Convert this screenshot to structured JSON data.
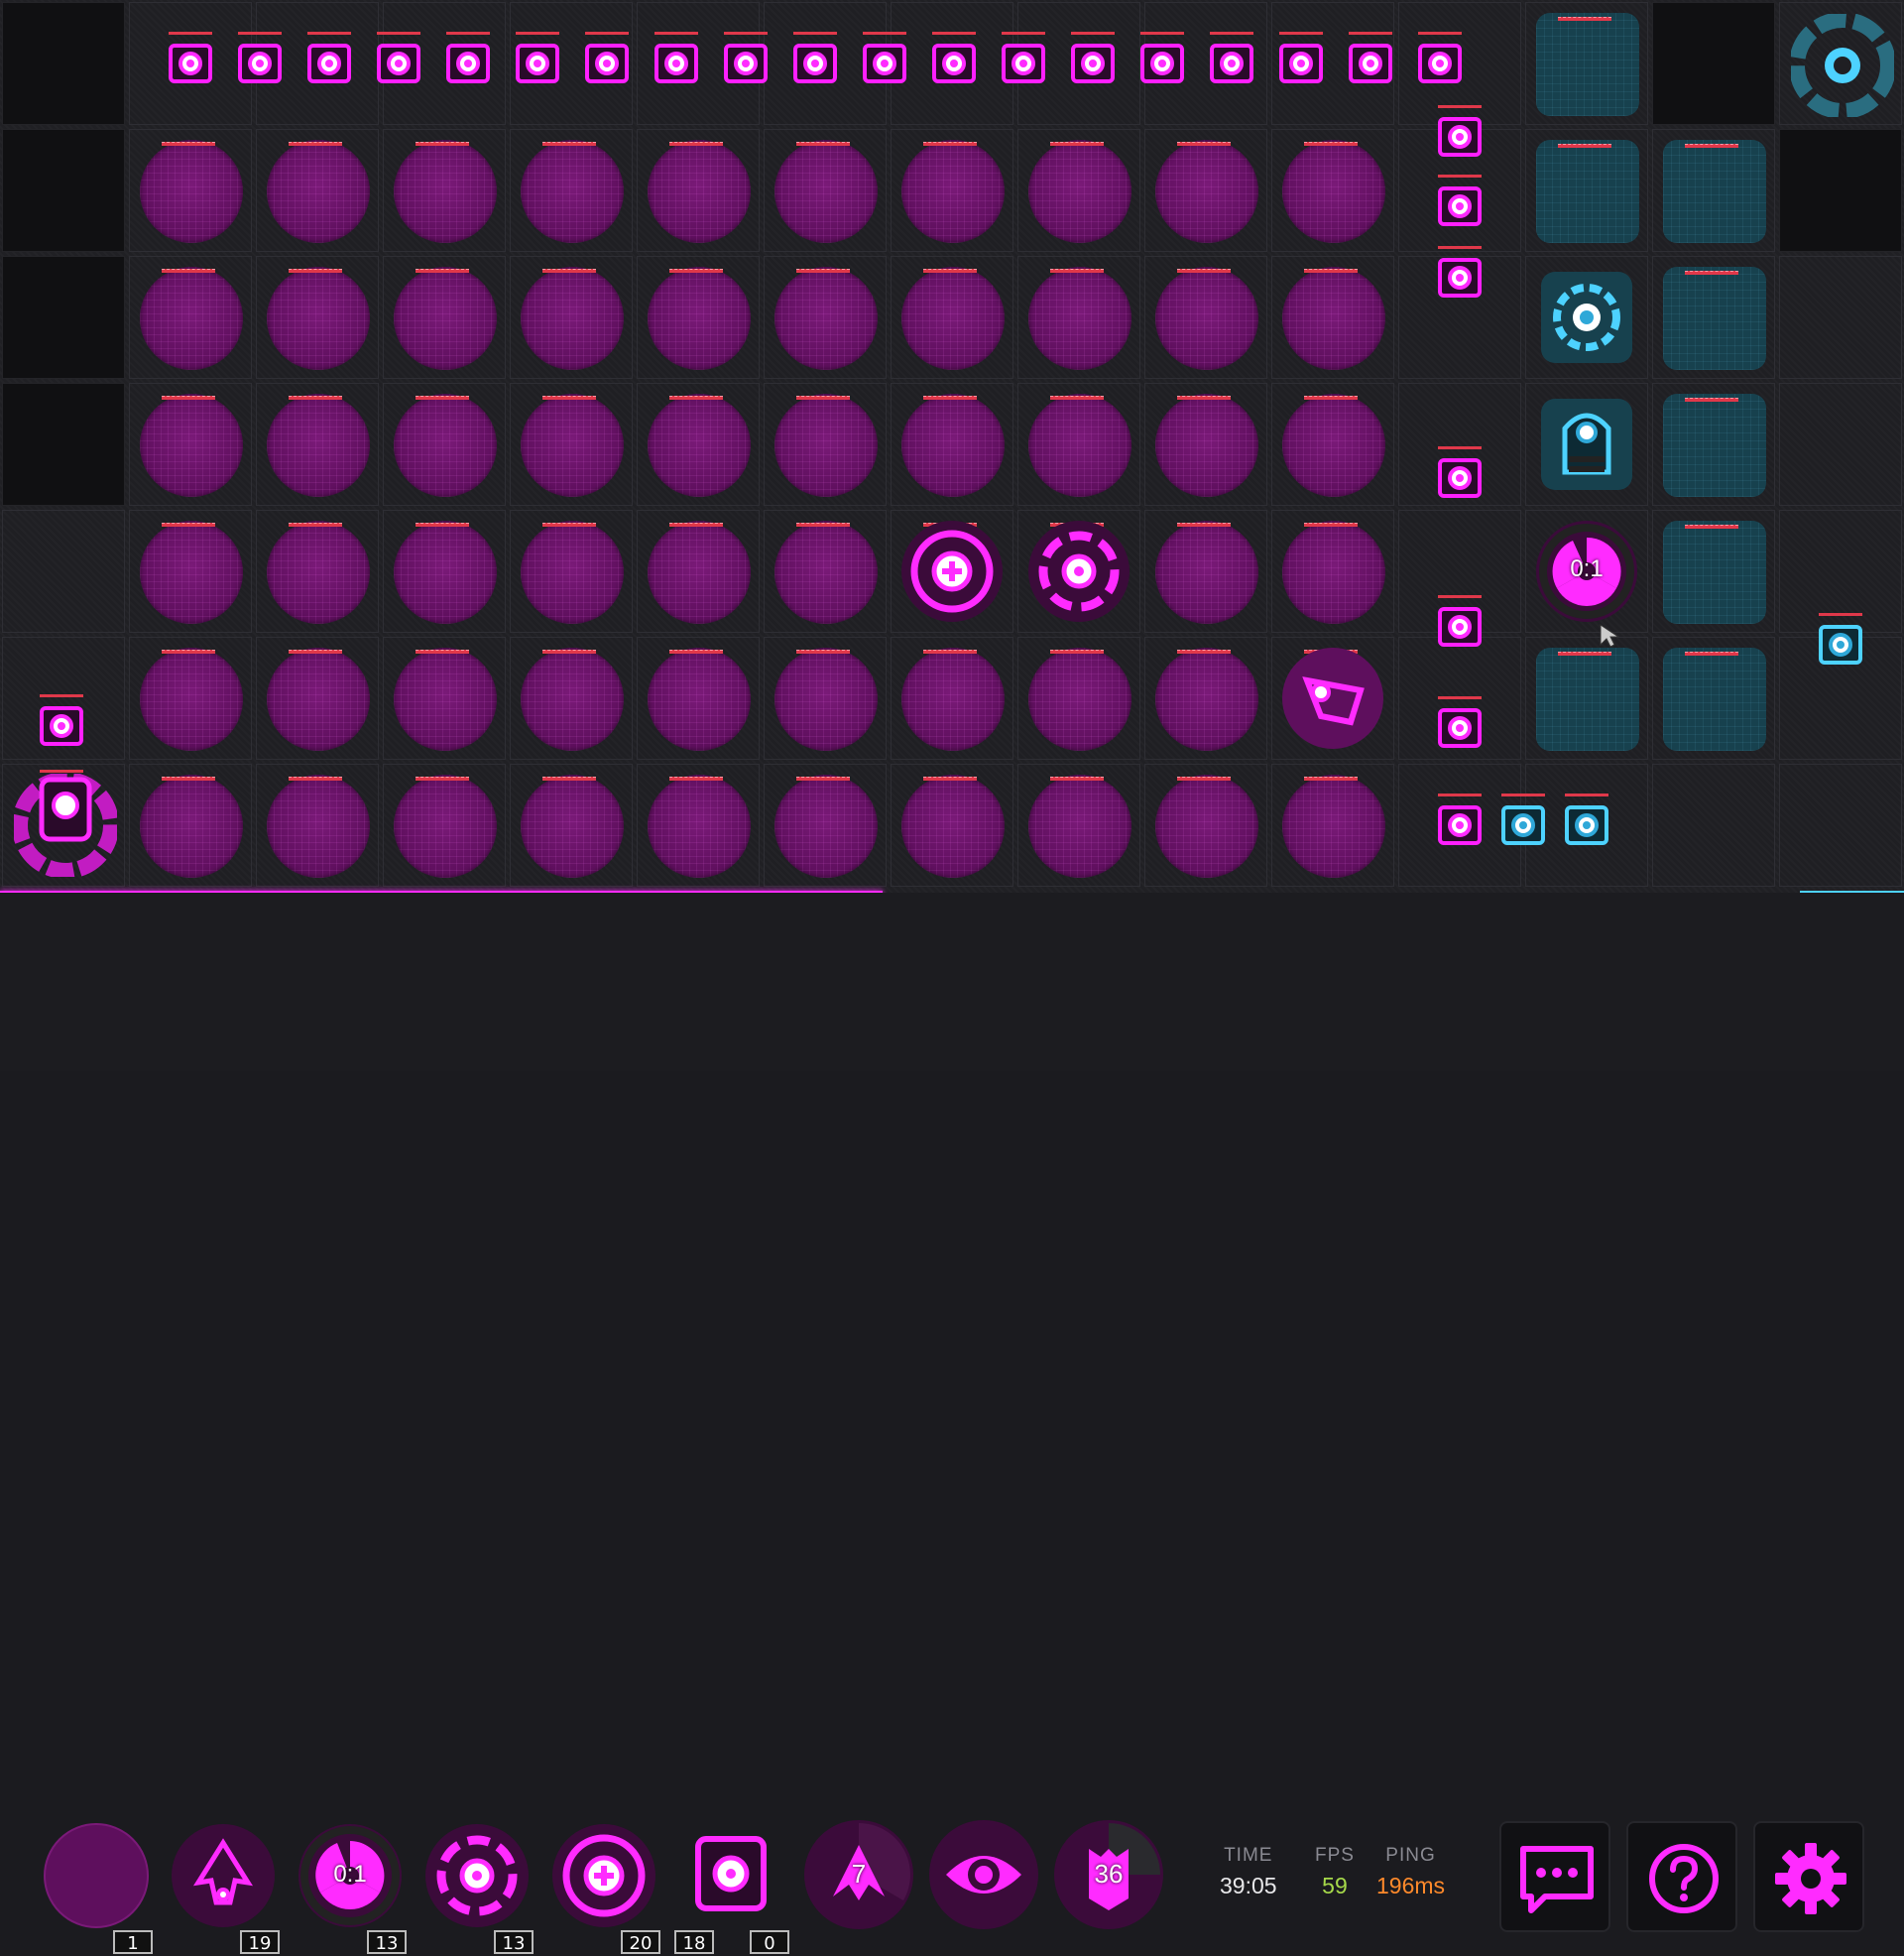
{
  "hud": {
    "time_label": "TIME",
    "time_value": "39:05",
    "fps_label": "FPS",
    "fps_value": "59",
    "ping_label": "PING",
    "ping_value": "196ms"
  },
  "colors": {
    "player": "#ff2bff",
    "enemy": "#4dd2ff",
    "orb": "#6a1568",
    "fps": "#a6d94a",
    "ping": "#ff8a2b"
  },
  "board": {
    "top_row_turrets": 19,
    "orb_rows": 7,
    "orb_cols": 10,
    "center_unit_a_icon": "plus-turret-icon",
    "center_unit_b_icon": "ring-turret-icon",
    "center_unit_c_icon": "drone-unit-icon",
    "enemy_timer_text": "0:1",
    "enemy_core_icon": "enemy-core-icon",
    "enemy_shield_icon": "gear-shield-icon"
  },
  "toolbar": {
    "slots": [
      {
        "icon": "orb-tile-icon",
        "count": "1"
      },
      {
        "icon": "drone-icon",
        "count": "19"
      },
      {
        "icon": "nuke-icon",
        "overlay": "0:1",
        "count": "13"
      },
      {
        "icon": "ring-turret-icon",
        "count": "13"
      },
      {
        "icon": "plus-turret-icon",
        "count": "20"
      },
      {
        "icon": "barrel-turret-icon",
        "count": "18",
        "count2": "0"
      }
    ],
    "abilities": [
      {
        "icon": "boost-icon",
        "value": "7"
      },
      {
        "icon": "eye-icon",
        "value": ""
      },
      {
        "icon": "shield-icon",
        "value": "36"
      }
    ],
    "buttons": [
      {
        "icon": "chat-icon"
      },
      {
        "icon": "help-icon"
      },
      {
        "icon": "gear-icon"
      }
    ]
  },
  "progress": {
    "player_fraction": 0.46,
    "enemy_fraction": 0.055
  }
}
